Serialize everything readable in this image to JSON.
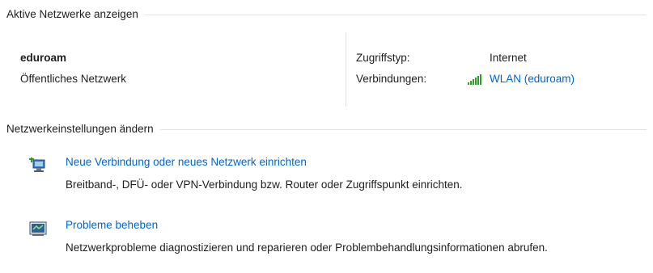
{
  "sections": {
    "active_networks_title": "Aktive Netzwerke anzeigen",
    "change_settings_title": "Netzwerkeinstellungen ändern"
  },
  "network": {
    "name": "eduroam",
    "category": "Öffentliches Netzwerk",
    "access_type_label": "Zugriffstyp:",
    "access_type_value": "Internet",
    "connections_label": "Verbindungen:",
    "connection_link": "WLAN (eduroam)",
    "connection_icon": "wifi-signal-icon"
  },
  "tasks": [
    {
      "icon": "network-setup-icon",
      "label": "Neue Verbindung oder neues Netzwerk einrichten",
      "description": "Breitband-, DFÜ- oder VPN-Verbindung bzw. Router oder Zugriffspunkt einrichten."
    },
    {
      "icon": "troubleshoot-icon",
      "label": "Probleme beheben",
      "description": "Netzwerkprobleme diagnostizieren und reparieren oder Problembehandlungsinformationen abrufen."
    }
  ],
  "colors": {
    "link": "#0066cc",
    "divider": "#e3e3e3",
    "wifi_signal": "#2e9a2e"
  }
}
